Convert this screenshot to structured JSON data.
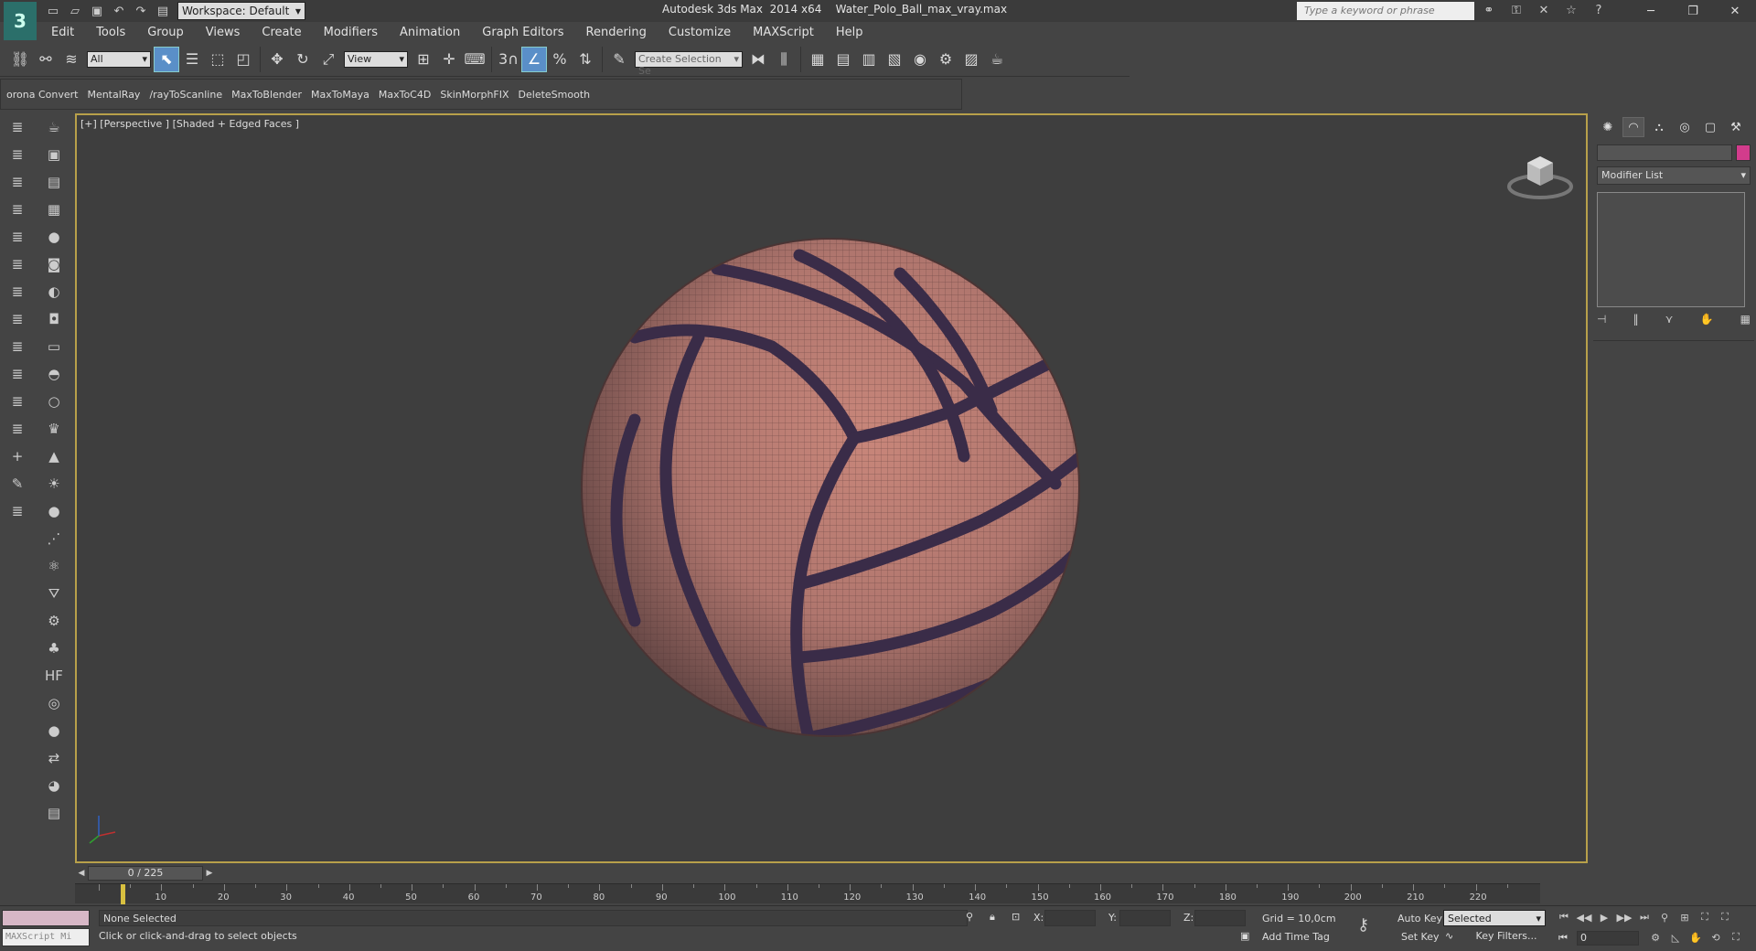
{
  "title": {
    "app": "Autodesk 3ds Max  2014 x64",
    "file": "Water_Polo_Ball_max_vray.max",
    "workspace": "Workspace: Default",
    "search_placeholder": "Type a keyword or phrase"
  },
  "menu": [
    "Edit",
    "Tools",
    "Group",
    "Views",
    "Create",
    "Modifiers",
    "Animation",
    "Graph Editors",
    "Rendering",
    "Customize",
    "MAXScript",
    "Help"
  ],
  "toolbar": {
    "selection_filter": "All",
    "ref_coord": "View",
    "named_selection": "Create Selection Se",
    "snap_label": "3"
  },
  "ribbon": [
    "orona Convert",
    "MentalRay",
    "/rayToScanline",
    "MaxToBlender",
    "MaxToMaya",
    "MaxToC4D",
    "SkinMorphFIX",
    "DeleteSmooth"
  ],
  "viewport": {
    "label": "[+] [Perspective ] [Shaded + Edged Faces ]"
  },
  "command_panel": {
    "modifier_list": "Modifier List",
    "object_color": "#d23c8c"
  },
  "time_slider": {
    "label": "0 / 225",
    "current": 0,
    "total": 225
  },
  "timeline_ticks": [
    "10",
    "20",
    "30",
    "40",
    "50",
    "60",
    "70",
    "80",
    "90",
    "100",
    "110",
    "120",
    "130",
    "140",
    "150",
    "160",
    "170",
    "180",
    "190",
    "200",
    "210",
    "220"
  ],
  "status": {
    "maxscript": "MAXScript Mi",
    "selection": "None Selected",
    "prompt": "Click or click-and-drag to select objects",
    "x_label": "X:",
    "y_label": "Y:",
    "z_label": "Z:",
    "grid": "Grid = 10,0cm",
    "add_time_tag": "Add Time Tag",
    "auto_key": "Auto Key",
    "set_key": "Set Key",
    "selected": "Selected",
    "key_filters": "Key Filters...",
    "frame": "0"
  }
}
